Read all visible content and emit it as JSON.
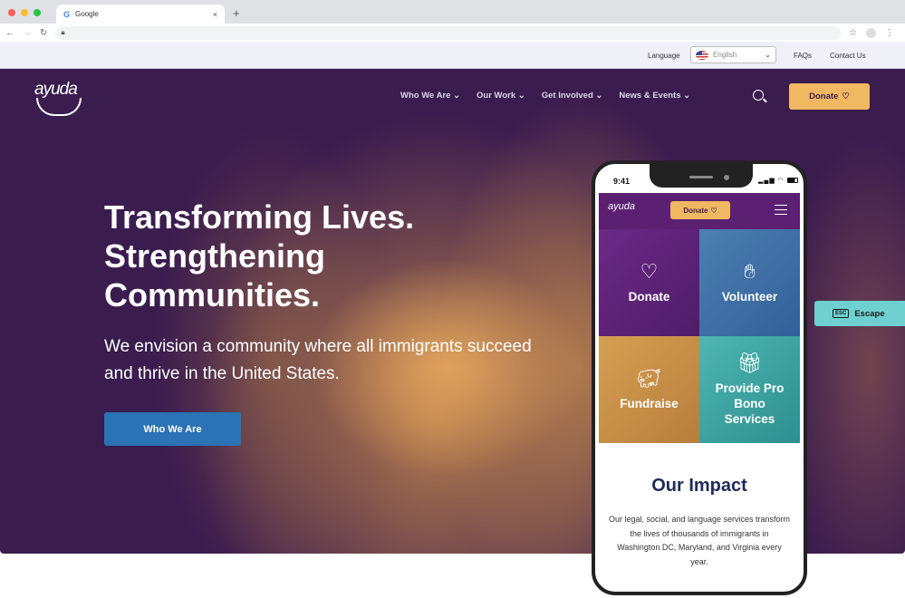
{
  "browser": {
    "tab_title": "Google",
    "tab_icon": "G",
    "new_tab": "+",
    "close_tab": "×"
  },
  "utility_bar": {
    "language_label": "Language",
    "language_value": "English",
    "faqs": "FAQs",
    "contact": "Contact Us"
  },
  "site": {
    "logo": "ayuda",
    "nav": [
      "Who We Are",
      "Our Work",
      "Get Involved",
      "News & Events"
    ],
    "donate_label": "Donate"
  },
  "hero": {
    "headline": "Transforming Lives. Strengthening Communities.",
    "subheadline": "We envision a community where all immigrants succeed and thrive in the United States.",
    "cta": "Who We Are"
  },
  "phone": {
    "time": "9:41",
    "logo": "ayuda",
    "donate_label": "Donate",
    "tiles": [
      {
        "label": "Donate",
        "icon": "heart-icon"
      },
      {
        "label": "Volunteer",
        "icon": "raised-hand-icon"
      },
      {
        "label": "Fundraise",
        "icon": "piggy-bank-icon"
      },
      {
        "label": "Provide Pro Bono Services",
        "icon": "gift-icon"
      }
    ],
    "impact_title": "Our Impact",
    "impact_body": "Our legal, social, and language services transform the lives of thousands of immigrants in Washington DC, Maryland, and Virginia every year."
  },
  "escape": {
    "key": "ESC",
    "label": "Escape"
  },
  "colors": {
    "brand_purple": "#3a1c4e",
    "donate_gold": "#f1b862",
    "cta_blue": "#2b73b5",
    "escape_teal": "#6ed0cf"
  }
}
